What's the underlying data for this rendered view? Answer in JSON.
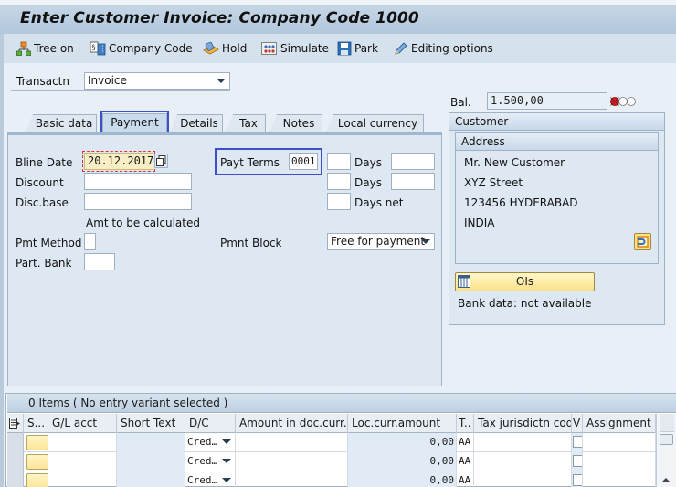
{
  "window": {
    "title": "Enter Customer Invoice: Company Code 1000"
  },
  "toolbar": {
    "buttons": [
      {
        "label": "Tree on",
        "icon": "tree-icon"
      },
      {
        "label": "Company Code",
        "icon": "company-code-icon"
      },
      {
        "label": "Hold",
        "icon": "hold-icon"
      },
      {
        "label": "Simulate",
        "icon": "simulate-icon"
      },
      {
        "label": "Park",
        "icon": "save-disk-icon"
      },
      {
        "label": "Editing options",
        "icon": "pencil-icon"
      }
    ]
  },
  "header": {
    "transaction_label": "Transactn",
    "transaction_value": "Invoice",
    "balance_label": "Bal.",
    "balance_value": "1.500,00",
    "status_light": "red"
  },
  "tabs": [
    {
      "label": "Basic data",
      "active": false
    },
    {
      "label": "Payment",
      "active": true
    },
    {
      "label": "Details",
      "active": false
    },
    {
      "label": "Tax",
      "active": false
    },
    {
      "label": "Notes",
      "active": false
    },
    {
      "label": "Local currency",
      "active": false
    }
  ],
  "payment": {
    "bline_date_label": "Bline Date",
    "bline_date_value": "20.12.2017",
    "discount_label": "Discount",
    "discount_value": "",
    "disc_base_label": "Disc.base",
    "disc_base_value": "",
    "amt_note": "Amt to be calculated",
    "pmt_method_label": "Pmt Method",
    "pmt_method_value": "",
    "part_bank_label": "Part. Bank",
    "part_bank_value": "",
    "payt_terms_label": "Payt Terms",
    "payt_terms_value": "0001",
    "days1_label": "Days",
    "days2_label": "Days",
    "days_net_label": "Days net",
    "pmnt_block_label": "Pmnt Block",
    "pmnt_block_value": "Free for payment"
  },
  "customer": {
    "group_title": "Customer",
    "address_title": "Address",
    "address_lines": [
      "Mr. New Customer",
      "XYZ Street",
      "123456 HYDERABAD",
      "INDIA"
    ],
    "ois_button": "OIs",
    "bank_data": "Bank data: not available"
  },
  "items": {
    "caption": "0 Items ( No entry variant selected )",
    "columns": [
      "S...",
      "G/L acct",
      "Short Text",
      "D/C",
      "Amount in doc.curr.",
      "Loc.curr.amount",
      "T..",
      "Tax jurisdictn code",
      "V",
      "Assignment"
    ],
    "rows": [
      {
        "gl_acct": "",
        "short_text": "",
        "dc": "Cred…",
        "amount_doc": "",
        "amount_loc": "0,00",
        "tax": "AA",
        "tax_jur": "",
        "assignment": ""
      },
      {
        "gl_acct": "",
        "short_text": "",
        "dc": "Cred…",
        "amount_doc": "",
        "amount_loc": "0,00",
        "tax": "AA",
        "tax_jur": "",
        "assignment": ""
      },
      {
        "gl_acct": "",
        "short_text": "",
        "dc": "Cred…",
        "amount_doc": "",
        "amount_loc": "0,00",
        "tax": "AA",
        "tax_jur": "",
        "assignment": ""
      }
    ]
  }
}
